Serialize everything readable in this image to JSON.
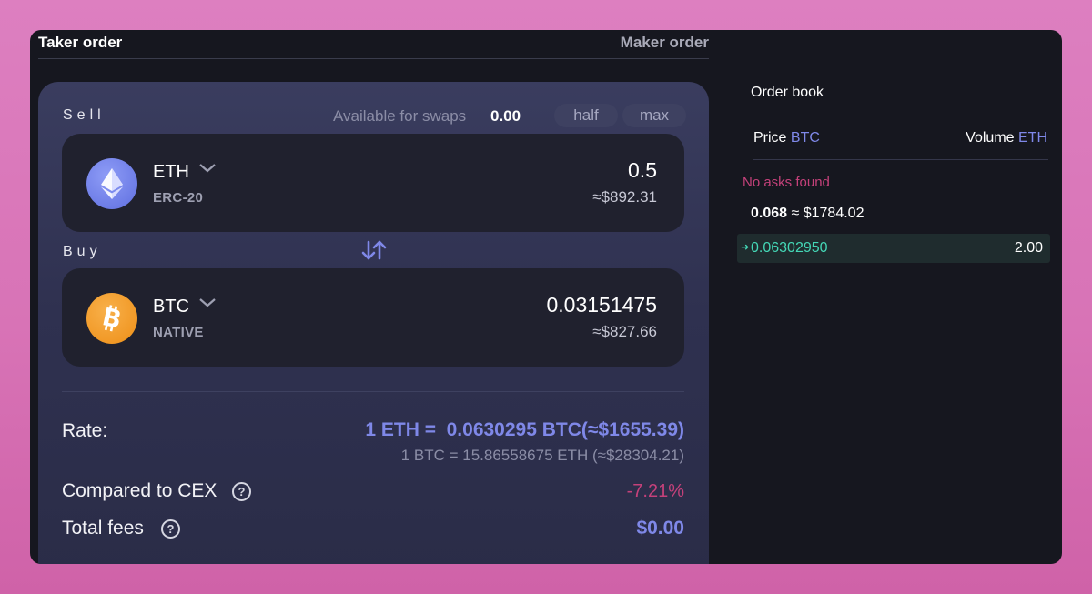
{
  "tabs": {
    "taker": "Taker order",
    "maker": "Maker order"
  },
  "sell": {
    "label": "Sell",
    "available_label": "Available for swaps",
    "available_value": "0.00",
    "half_label": "half",
    "max_label": "max",
    "ticker": "ETH",
    "network": "ERC-20",
    "amount": "0.5",
    "amount_usd": "≈$892.31"
  },
  "buy": {
    "label": "Buy",
    "ticker": "BTC",
    "network": "NATIVE",
    "amount": "0.03151475",
    "amount_usd": "≈$827.66"
  },
  "rate": {
    "label": "Rate:",
    "primary": "1 ETH =  0.0630295 BTC(≈$1655.39)",
    "secondary": "1 BTC = 15.86558675 ETH (≈$28304.21)"
  },
  "compare": {
    "label": "Compared to CEX",
    "value": "-7.21%"
  },
  "fees": {
    "label": "Total fees",
    "value": "$0.00"
  },
  "orderbook": {
    "title": "Order book",
    "price_label": "Price",
    "price_unit": "BTC",
    "volume_label": "Volume",
    "volume_unit": "ETH",
    "no_asks": "No asks found",
    "mid_price": "0.068",
    "mid_price_usd": "≈ $1784.02",
    "bids": [
      {
        "price": "0.06302950",
        "volume": "2.00"
      }
    ]
  },
  "colors": {
    "accent": "#7f88e8",
    "negative": "#c4417a",
    "bid": "#44d7b6",
    "card": "#2f3150",
    "panel": "#16171f"
  }
}
